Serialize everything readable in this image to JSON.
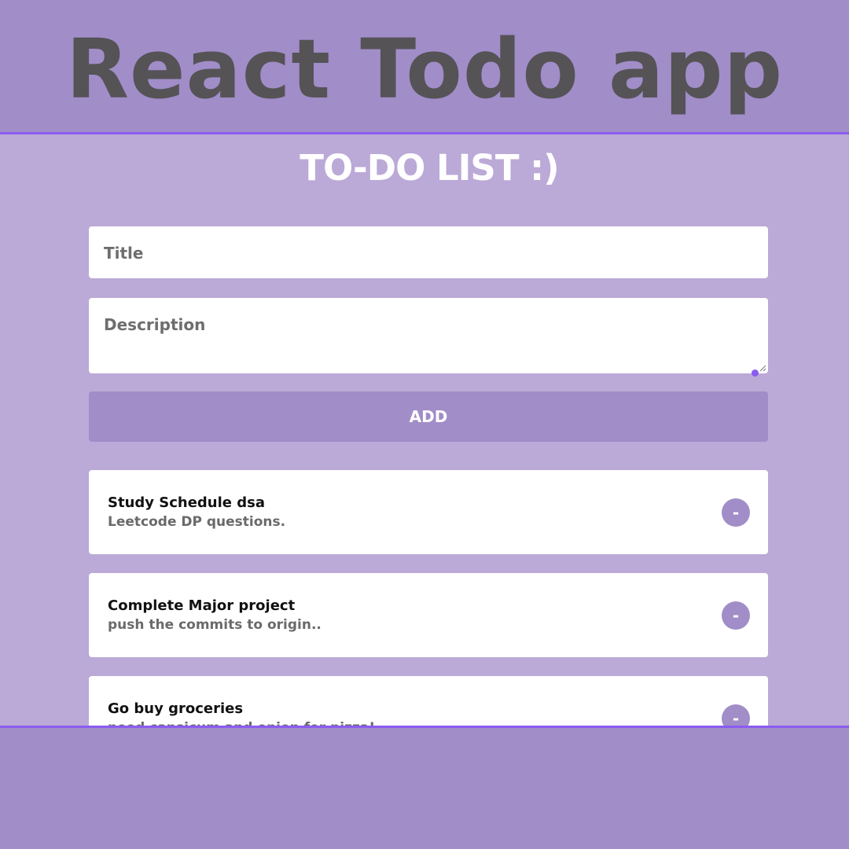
{
  "banner": {
    "title": "React Todo app"
  },
  "app": {
    "heading": "TO-DO LIST :)",
    "title_input": {
      "placeholder": "Title",
      "value": ""
    },
    "description_input": {
      "placeholder": "Description",
      "value": ""
    },
    "add_label": "ADD",
    "remove_label": "-"
  },
  "todos": [
    {
      "title": "Study Schedule dsa",
      "description": "Leetcode DP questions."
    },
    {
      "title": "Complete Major project",
      "description": "push the commits to origin.."
    },
    {
      "title": "Go buy groceries",
      "description": "need capsicum and onion for pizza!"
    }
  ],
  "colors": {
    "outer_background": "#a18dc8",
    "app_background": "#bba9d7",
    "accent_border": "#8a5cf0",
    "button": "#a18dc8",
    "banner_text": "#555356"
  }
}
